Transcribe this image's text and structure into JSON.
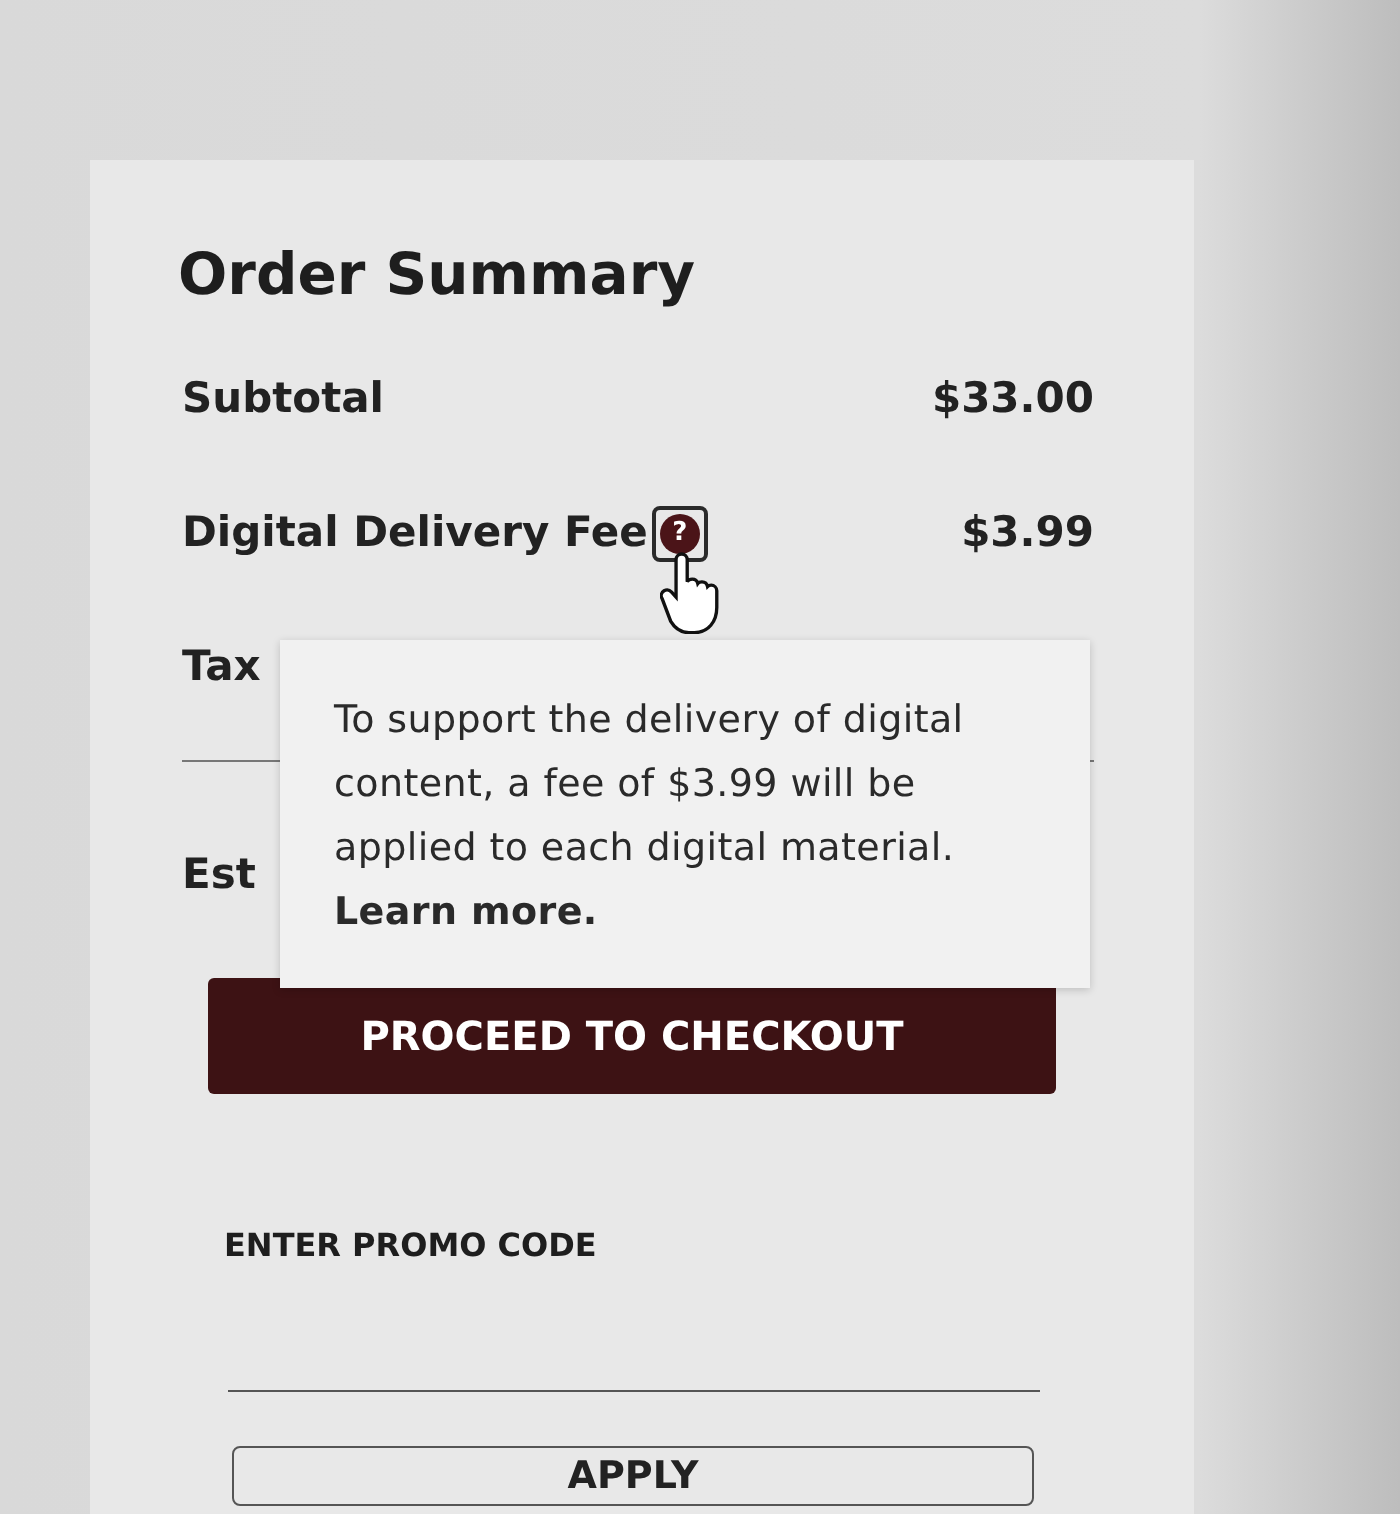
{
  "heading": "Order Summary",
  "lines": [
    {
      "kind": "item",
      "label": "Subtotal",
      "value": "$33.00"
    },
    {
      "kind": "item",
      "label": "Digital Delivery Fee",
      "help": "?",
      "value": "$3.99"
    },
    {
      "kind": "item",
      "label": "Tax"
    },
    {
      "kind": "total",
      "label": "Est"
    }
  ],
  "tooltip": {
    "text": "To support the delivery of digital content, a fee of $3.99 will be applied to each digital material.",
    "link": "Learn more."
  },
  "checkout_button": "PROCEED TO CHECKOUT",
  "promo": {
    "label": "ENTER PROMO CODE",
    "button": "APPLY"
  }
}
